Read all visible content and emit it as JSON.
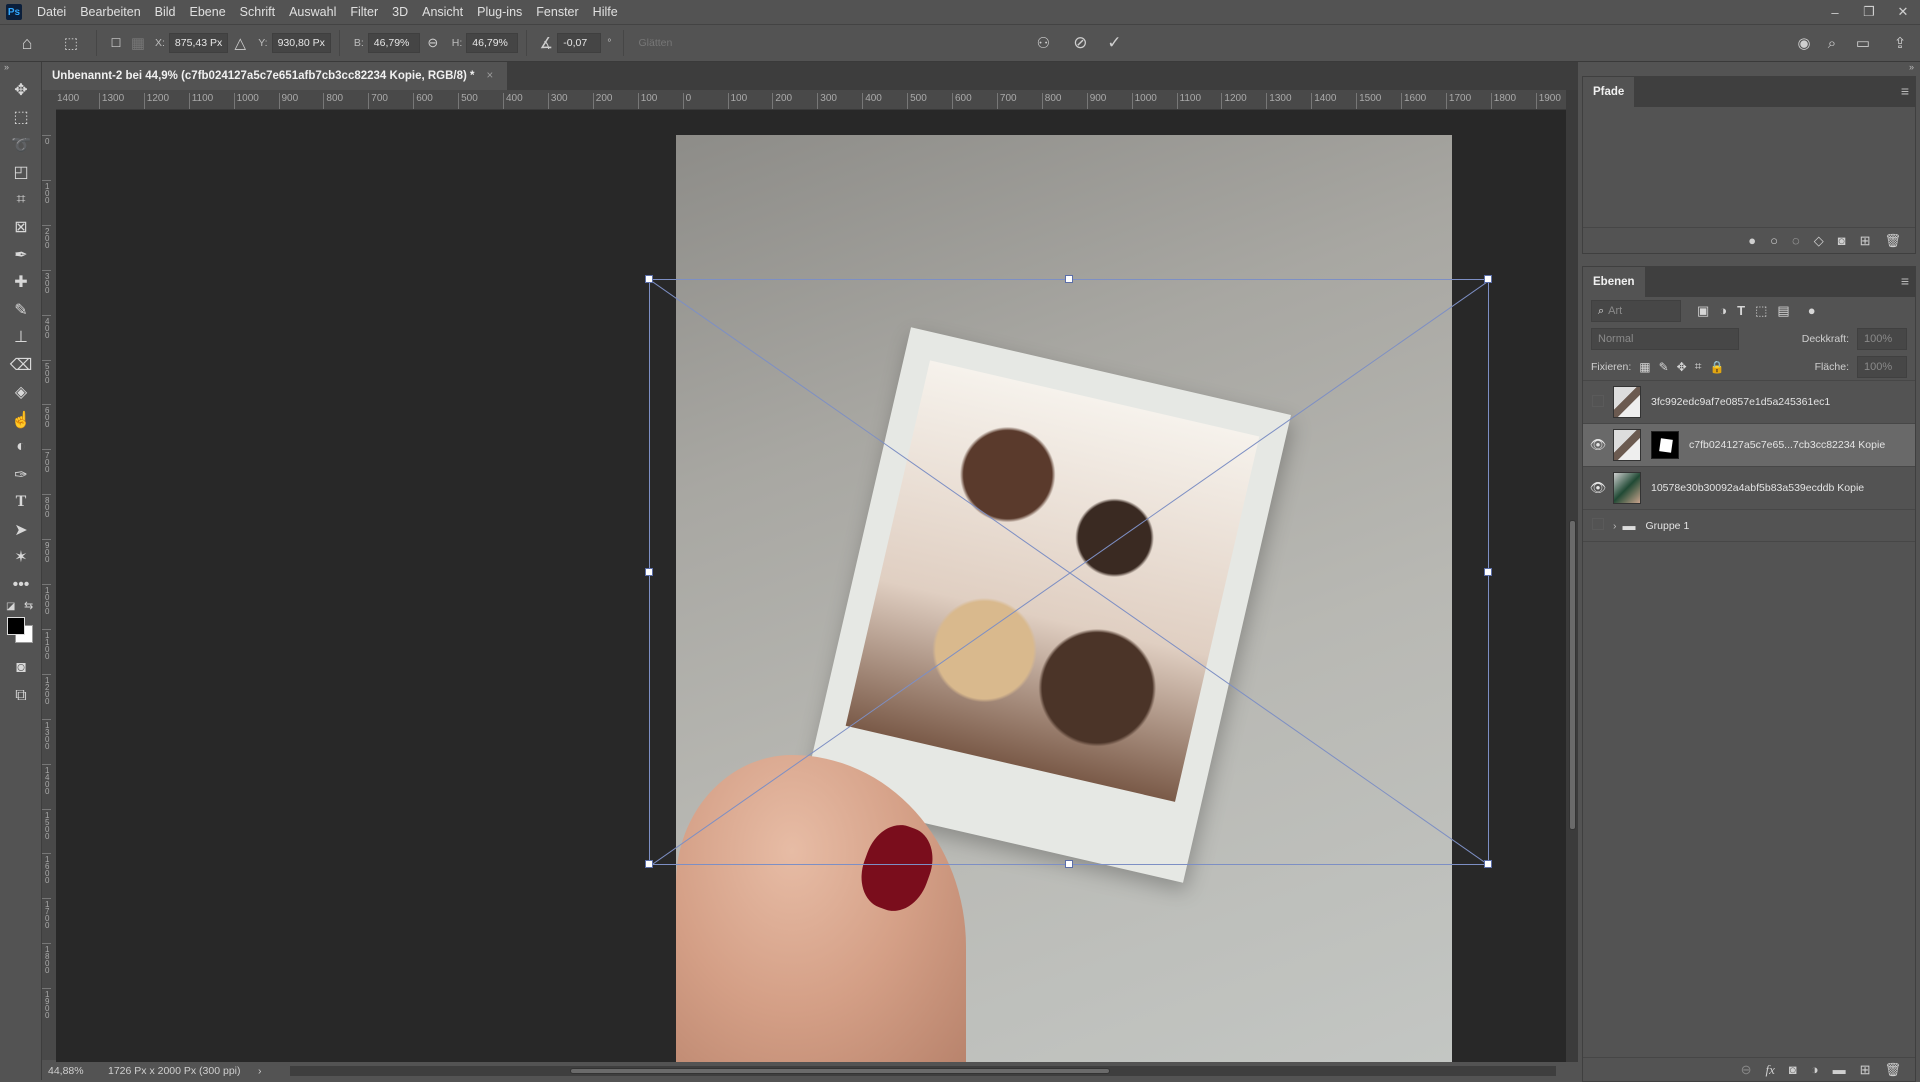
{
  "app": {
    "logo": "Ps"
  },
  "menubar": {
    "items": [
      "Datei",
      "Bearbeiten",
      "Bild",
      "Ebene",
      "Schrift",
      "Auswahl",
      "Filter",
      "3D",
      "Ansicht",
      "Plug-ins",
      "Fenster",
      "Hilfe"
    ],
    "window_controls": {
      "minimize": "–",
      "restore": "❐",
      "close": "✕"
    }
  },
  "options": {
    "x_label": "X:",
    "x_value": "875,43 Px",
    "y_label": "Y:",
    "y_value": "930,80 Px",
    "w_label": "B:",
    "w_value": "46,79%",
    "h_label": "H:",
    "h_value": "46,79%",
    "angle_value": "-0,07",
    "angle_unit": "°",
    "smooth_label": "Glätten"
  },
  "document": {
    "tab_title": "Unbenannt-2 bei 44,9% (c7fb024127a5c7e651afb7cb3cc82234 Kopie, RGB/8) *",
    "close": "×"
  },
  "ruler_h": [
    "1400",
    "1300",
    "1200",
    "1100",
    "1000",
    "900",
    "800",
    "700",
    "600",
    "500",
    "400",
    "300",
    "200",
    "100",
    "0",
    "100",
    "200",
    "300",
    "400",
    "500",
    "600",
    "700",
    "800",
    "900",
    "1000",
    "1100",
    "1200",
    "1300",
    "1400",
    "1500",
    "1600",
    "1700",
    "1800",
    "1900"
  ],
  "ruler_v": [
    "0",
    "100",
    "200",
    "300",
    "400",
    "500",
    "600",
    "700",
    "800",
    "900",
    "1000",
    "1100",
    "1200",
    "1300",
    "1400",
    "1500",
    "1600",
    "1700",
    "1800",
    "1900"
  ],
  "status": {
    "zoom": "44,88%",
    "doc_size": "1726 Px x 2000 Px (300 ppi)",
    "arrow": "›"
  },
  "paths_panel": {
    "tab": "Pfade"
  },
  "layers_panel": {
    "tab": "Ebenen",
    "search_placeholder": "Art",
    "blend_mode": "Normal",
    "opacity_label": "Deckkraft:",
    "opacity_value": "100%",
    "lock_label": "Fixieren:",
    "fill_label": "Fläche:",
    "fill_value": "100%",
    "layers": [
      {
        "name": "3fc992edc9af7e0857e1d5a245361ec1",
        "visible": false,
        "selected": false,
        "mask": false
      },
      {
        "name": "c7fb024127a5c7e65...7cb3cc82234 Kopie",
        "visible": true,
        "selected": true,
        "mask": true
      },
      {
        "name": "10578e30b30092a4abf5b83a539ecddb Kopie",
        "visible": true,
        "selected": false,
        "mask": false
      },
      {
        "name": "Gruppe 1",
        "visible": false,
        "selected": false,
        "group": true
      }
    ]
  }
}
